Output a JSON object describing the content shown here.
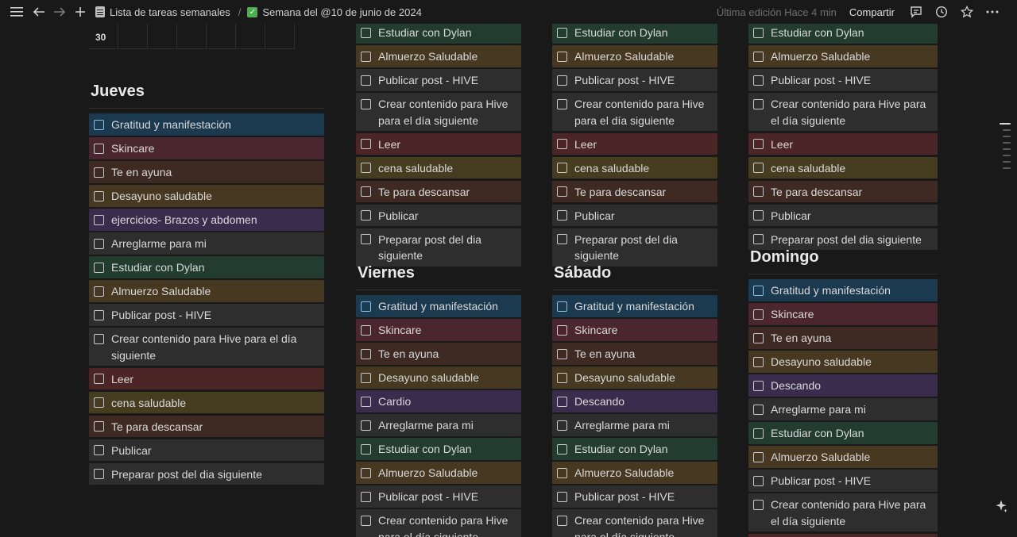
{
  "topbar": {
    "breadcrumb_1": "Lista de tareas semanales",
    "separator": "/",
    "breadcrumb_2": "Semana del @10 de junio de 2024",
    "last_edited": "Última edición Hace 4 min",
    "share": "Compartir"
  },
  "calendar_fragment": {
    "day": "30"
  },
  "columns": {
    "jueves": {
      "title": "Jueves",
      "tasks": [
        {
          "text": "Gratitud y manifestación",
          "color": "blue"
        },
        {
          "text": "Skincare",
          "color": "pink"
        },
        {
          "text": "Te en ayuna",
          "color": "brown"
        },
        {
          "text": "Desayuno saludable",
          "color": "orange"
        },
        {
          "text": "ejercicios- Brazos y abdomen",
          "color": "purple"
        },
        {
          "text": "Arreglarme para mi",
          "color": "gray"
        },
        {
          "text": "Estudiar con Dylan",
          "color": "green"
        },
        {
          "text": "Almuerzo Saludable",
          "color": "orange"
        },
        {
          "text": "Publicar post - HIVE",
          "color": "gray"
        },
        {
          "text": "Crear contenido para Hive para el día siguiente",
          "color": "gray"
        },
        {
          "text": "Leer",
          "color": "red"
        },
        {
          "text": "cena saludable",
          "color": "yellow"
        },
        {
          "text": "Te para descansar",
          "color": "brown"
        },
        {
          "text": "Publicar",
          "color": "gray"
        },
        {
          "text": "Preparar post del dia siguiente",
          "color": "gray"
        }
      ]
    },
    "col2_top": {
      "tasks": [
        {
          "text": "Estudiar con Dylan",
          "color": "green"
        },
        {
          "text": "Almuerzo Saludable",
          "color": "orange"
        },
        {
          "text": "Publicar post - HIVE",
          "color": "gray"
        },
        {
          "text": "Crear contenido para Hive para el día siguiente",
          "color": "gray"
        },
        {
          "text": "Leer",
          "color": "red"
        },
        {
          "text": "cena saludable",
          "color": "yellow"
        },
        {
          "text": "Te para descansar",
          "color": "brown"
        },
        {
          "text": "Publicar",
          "color": "gray"
        },
        {
          "text": "Preparar post del dia siguiente",
          "color": "gray"
        }
      ]
    },
    "viernes": {
      "title": "Viernes",
      "tasks": [
        {
          "text": "Gratitud y manifestación",
          "color": "blue"
        },
        {
          "text": "Skincare",
          "color": "pink"
        },
        {
          "text": "Te en ayuna",
          "color": "brown"
        },
        {
          "text": "Desayuno saludable",
          "color": "orange"
        },
        {
          "text": "Cardio",
          "color": "purple"
        },
        {
          "text": "Arreglarme para mi",
          "color": "gray"
        },
        {
          "text": "Estudiar con Dylan",
          "color": "green"
        },
        {
          "text": "Almuerzo Saludable",
          "color": "orange"
        },
        {
          "text": "Publicar post - HIVE",
          "color": "gray"
        },
        {
          "text": "Crear contenido para Hive para el día siguiente",
          "color": "gray"
        }
      ]
    },
    "col3_top": {
      "tasks": [
        {
          "text": "Estudiar con Dylan",
          "color": "green"
        },
        {
          "text": "Almuerzo Saludable",
          "color": "orange"
        },
        {
          "text": "Publicar post - HIVE",
          "color": "gray"
        },
        {
          "text": "Crear contenido para Hive para el día siguiente",
          "color": "gray"
        },
        {
          "text": "Leer",
          "color": "red"
        },
        {
          "text": "cena saludable",
          "color": "yellow"
        },
        {
          "text": "Te para descansar",
          "color": "brown"
        },
        {
          "text": "Publicar",
          "color": "gray"
        },
        {
          "text": "Preparar post del dia siguiente",
          "color": "gray"
        }
      ]
    },
    "sabado": {
      "title": "Sábado",
      "tasks": [
        {
          "text": "Gratitud y manifestación",
          "color": "blue"
        },
        {
          "text": "Skincare",
          "color": "pink"
        },
        {
          "text": "Te en ayuna",
          "color": "brown"
        },
        {
          "text": "Desayuno saludable",
          "color": "orange"
        },
        {
          "text": "Descando",
          "color": "purple"
        },
        {
          "text": "Arreglarme para mi",
          "color": "gray"
        },
        {
          "text": "Estudiar con Dylan",
          "color": "green"
        },
        {
          "text": "Almuerzo Saludable",
          "color": "orange"
        },
        {
          "text": "Publicar post - HIVE",
          "color": "gray"
        },
        {
          "text": "Crear contenido para Hive para el día siguiente",
          "color": "gray"
        }
      ]
    },
    "col4_top": {
      "tasks": [
        {
          "text": "Estudiar con Dylan",
          "color": "green"
        },
        {
          "text": "Almuerzo Saludable",
          "color": "orange"
        },
        {
          "text": "Publicar post - HIVE",
          "color": "gray"
        },
        {
          "text": "Crear contenido para Hive para el día siguiente",
          "color": "gray"
        },
        {
          "text": "Leer",
          "color": "red"
        },
        {
          "text": "cena saludable",
          "color": "yellow"
        },
        {
          "text": "Te para descansar",
          "color": "brown"
        },
        {
          "text": "Publicar",
          "color": "gray"
        },
        {
          "text": "Preparar post del dia siguiente",
          "color": "gray"
        }
      ]
    },
    "domingo": {
      "title": "Domingo",
      "tasks": [
        {
          "text": "Gratitud y manifestación",
          "color": "blue"
        },
        {
          "text": "Skincare",
          "color": "pink"
        },
        {
          "text": "Te en ayuna",
          "color": "brown"
        },
        {
          "text": "Desayuno saludable",
          "color": "orange"
        },
        {
          "text": "Descando",
          "color": "purple"
        },
        {
          "text": "Arreglarme para mi",
          "color": "gray"
        },
        {
          "text": "Estudiar con Dylan",
          "color": "green"
        },
        {
          "text": "Almuerzo Saludable",
          "color": "orange"
        },
        {
          "text": "Publicar post - HIVE",
          "color": "gray"
        },
        {
          "text": "Crear contenido para Hive para el día siguiente",
          "color": "gray"
        },
        {
          "text": "Leer",
          "color": "red"
        }
      ]
    }
  },
  "icons": {
    "menu": "menu-icon",
    "back": "arrow-left-icon",
    "forward": "arrow-right-icon",
    "add": "plus-icon",
    "comments": "comment-icon",
    "history": "clock-icon",
    "favorite": "star-icon",
    "more": "more-icon",
    "ai": "sparkle-icon"
  }
}
